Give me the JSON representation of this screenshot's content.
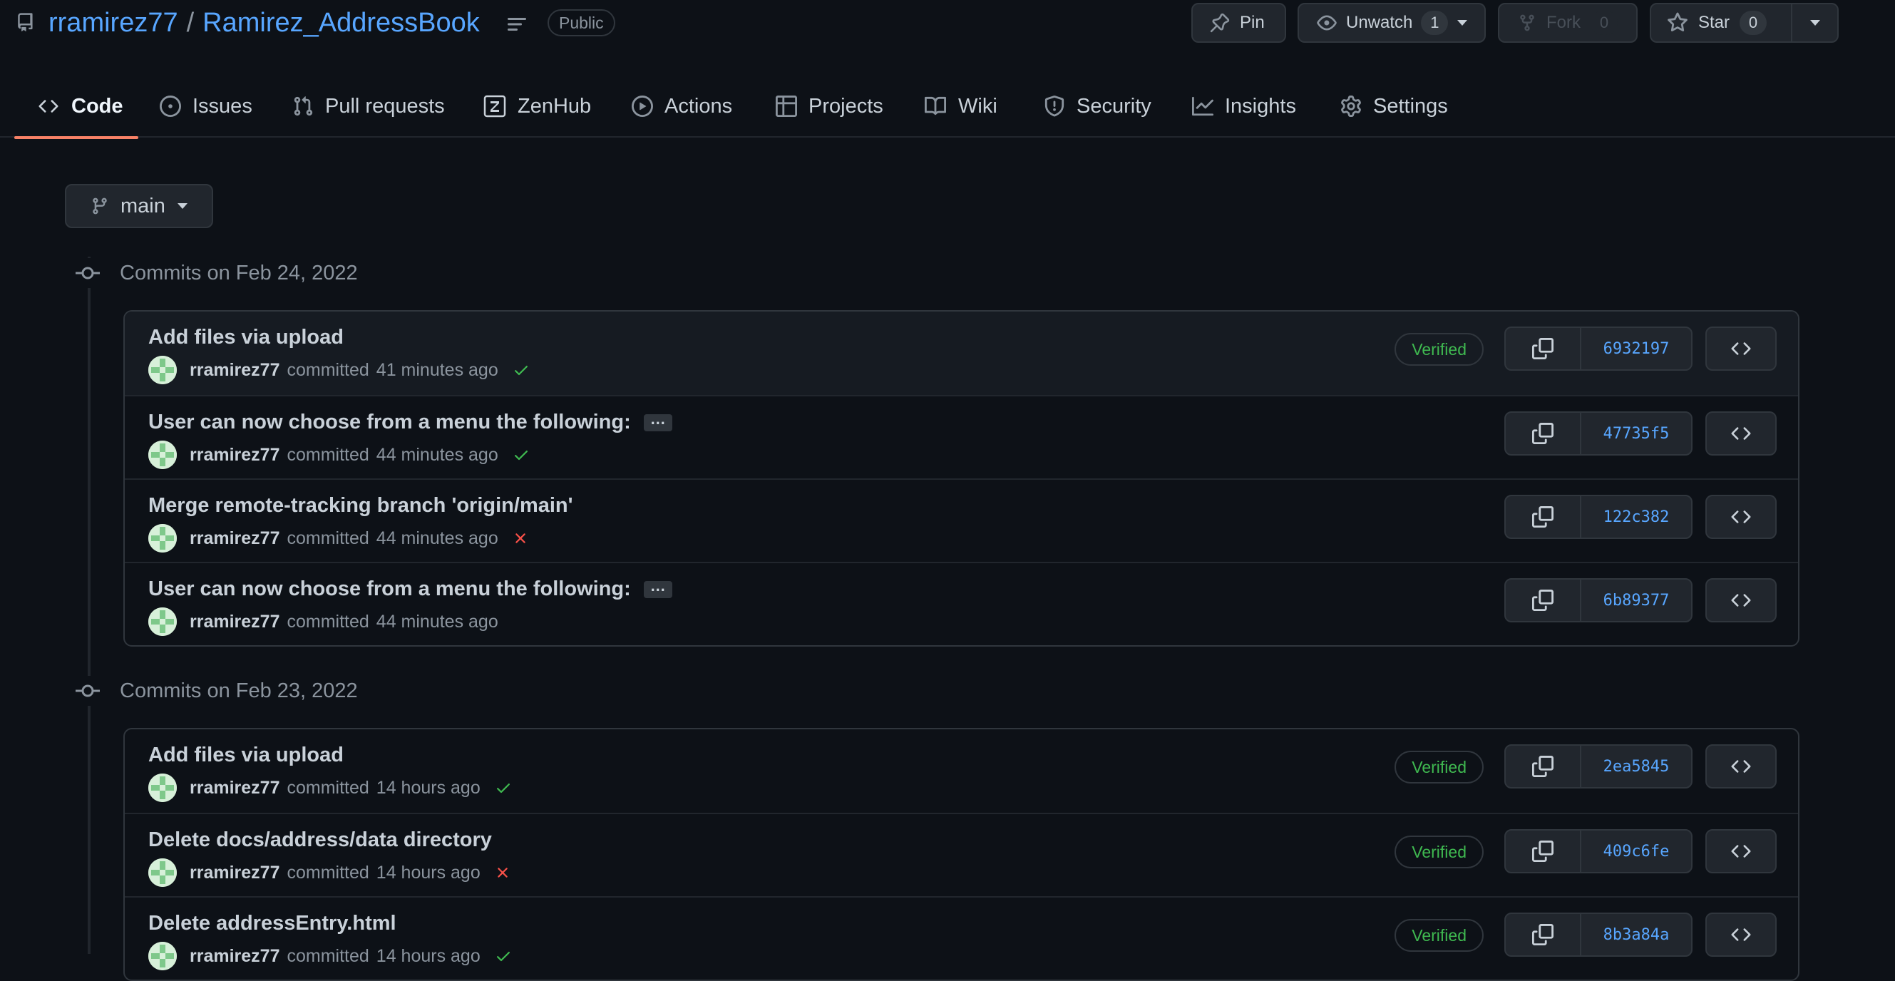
{
  "repo": {
    "owner": "rramirez77",
    "separator": "/",
    "name": "Ramirez_AddressBook",
    "visibility": "Public"
  },
  "actions": {
    "pin": "Pin",
    "unwatch": "Unwatch",
    "unwatch_count": "1",
    "fork": "Fork",
    "fork_count": "0",
    "star": "Star",
    "star_count": "0"
  },
  "nav": {
    "tabs": [
      {
        "label": "Code",
        "icon": "code-icon",
        "active": true
      },
      {
        "label": "Issues",
        "icon": "issue-icon"
      },
      {
        "label": "Pull requests",
        "icon": "pull-request-icon"
      },
      {
        "label": "ZenHub",
        "icon": "zenhub-icon"
      },
      {
        "label": "Actions",
        "icon": "play-icon"
      },
      {
        "label": "Projects",
        "icon": "table-icon"
      },
      {
        "label": "Wiki",
        "icon": "book-icon"
      },
      {
        "label": "Security",
        "icon": "shield-icon"
      },
      {
        "label": "Insights",
        "icon": "graph-icon"
      },
      {
        "label": "Settings",
        "icon": "gear-icon"
      }
    ]
  },
  "branch": {
    "name": "main"
  },
  "groups": [
    {
      "date_label": "Commits on Feb 24, 2022",
      "commits": [
        {
          "message": "Add files via upload",
          "author": "rramirez77",
          "action": "committed",
          "time": "41 minutes ago",
          "status": "success",
          "verified": "Verified",
          "sha": "6932197",
          "highlight": true
        },
        {
          "message": "User can now choose from a menu the following:",
          "has_more": true,
          "author": "rramirez77",
          "action": "committed",
          "time": "44 minutes ago",
          "status": "success",
          "sha": "47735f5"
        },
        {
          "message": "Merge remote-tracking branch 'origin/main'",
          "author": "rramirez77",
          "action": "committed",
          "time": "44 minutes ago",
          "status": "failure",
          "sha": "122c382"
        },
        {
          "message": "User can now choose from a menu the following:",
          "has_more": true,
          "author": "rramirez77",
          "action": "committed",
          "time": "44 minutes ago",
          "sha": "6b89377"
        }
      ]
    },
    {
      "date_label": "Commits on Feb 23, 2022",
      "commits": [
        {
          "message": "Add files via upload",
          "author": "rramirez77",
          "action": "committed",
          "time": "14 hours ago",
          "status": "success",
          "verified": "Verified",
          "sha": "2ea5845"
        },
        {
          "message": "Delete docs/address/data directory",
          "author": "rramirez77",
          "action": "committed",
          "time": "14 hours ago",
          "status": "failure",
          "verified": "Verified",
          "sha": "409c6fe"
        },
        {
          "message": "Delete addressEntry.html",
          "author": "rramirez77",
          "action": "committed",
          "time": "14 hours ago",
          "status": "success",
          "verified": "Verified",
          "sha": "8b3a84a"
        }
      ]
    }
  ],
  "ellipsis": "…",
  "colors": {
    "background": "#0d1117",
    "link": "#58a6ff",
    "success": "#3fb950",
    "failure": "#f85149",
    "active_tab_underline": "#f78166"
  }
}
